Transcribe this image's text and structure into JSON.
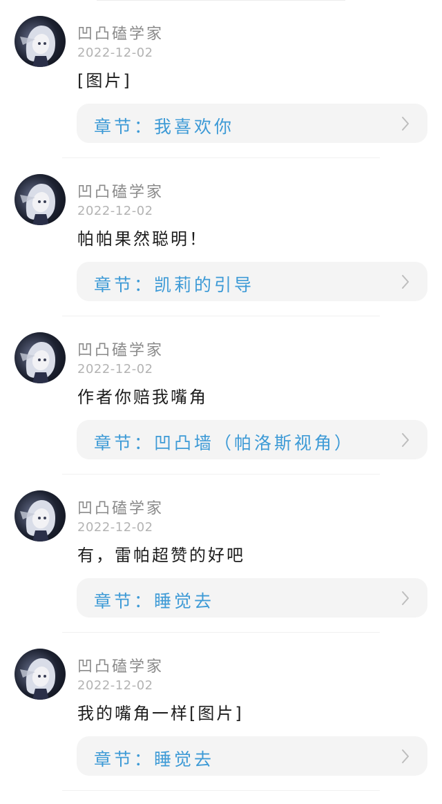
{
  "comments": [
    {
      "username": "凹凸磕学家",
      "date": "2022-12-02",
      "content": "[图片]",
      "chapter_label": "章节：我喜欢你"
    },
    {
      "username": "凹凸磕学家",
      "date": "2022-12-02",
      "content": "帕帕果然聪明！",
      "chapter_label": "章节：凯莉的引导"
    },
    {
      "username": "凹凸磕学家",
      "date": "2022-12-02",
      "content": "作者你赔我嘴角",
      "chapter_label": "章节：凹凸墙（帕洛斯视角）"
    },
    {
      "username": "凹凸磕学家",
      "date": "2022-12-02",
      "content": "有，雷帕超赞的好吧",
      "chapter_label": "章节：睡觉去"
    },
    {
      "username": "凹凸磕学家",
      "date": "2022-12-02",
      "content": "我的嘴角一样[图片]",
      "chapter_label": "章节：睡觉去"
    }
  ],
  "icons": {
    "chevron": "chevron-right-icon",
    "avatar": "anime-avatar"
  },
  "colors": {
    "chapter_text": "#3d9ad6",
    "chapter_card_bg": "#f4f4f4",
    "username": "#8a8a8a",
    "date": "#b3b3b3",
    "content": "#1c1c1c"
  }
}
